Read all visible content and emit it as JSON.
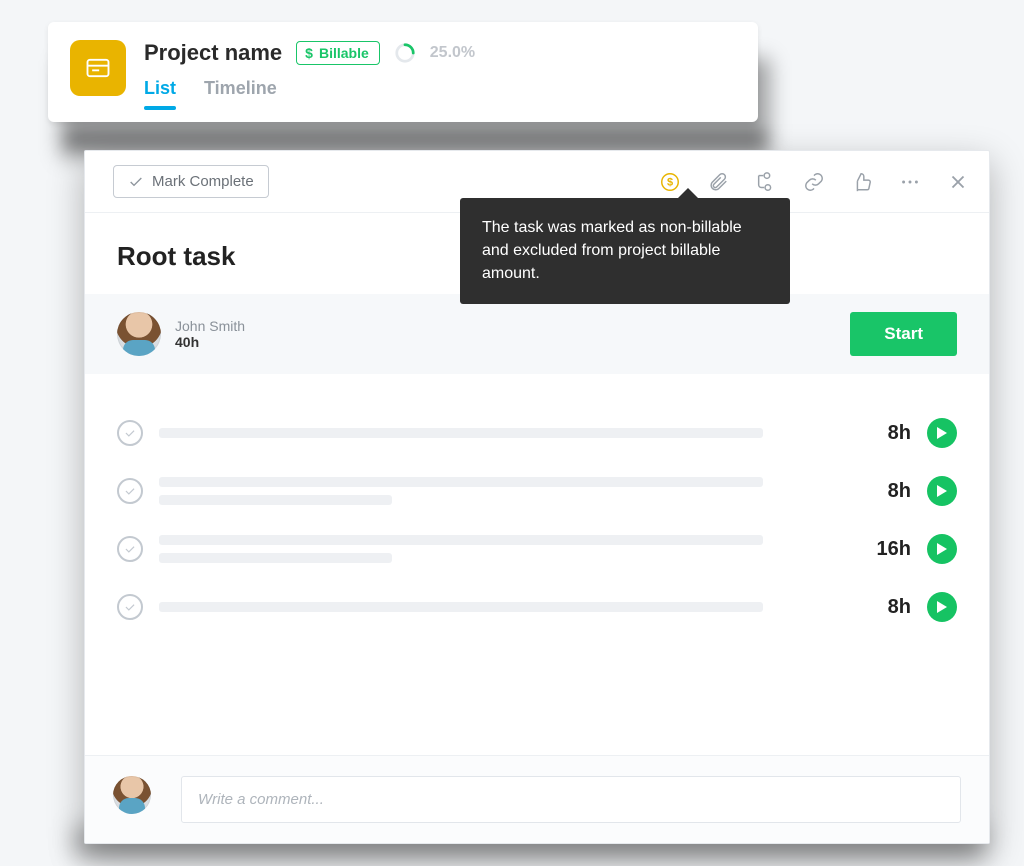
{
  "project": {
    "title": "Project name",
    "billable_label": "Billable",
    "progress_text": "25.0%",
    "progress_value": 25.0,
    "tabs": [
      {
        "label": "List",
        "active": true
      },
      {
        "label": "Timeline",
        "active": false
      }
    ]
  },
  "task_panel": {
    "mark_complete_label": "Mark Complete",
    "toolbar_icons": [
      {
        "name": "billable-icon",
        "tooltip_target": true
      },
      {
        "name": "attachment-icon"
      },
      {
        "name": "subtask-tree-icon"
      },
      {
        "name": "link-icon"
      },
      {
        "name": "like-icon"
      },
      {
        "name": "more-icon"
      },
      {
        "name": "close-icon"
      }
    ],
    "title": "Root task",
    "tooltip_text": "The task was marked as non-billable and  excluded from project billable amount.",
    "assignee": {
      "name": "John Smith",
      "hours": "40h"
    },
    "start_label": "Start",
    "subtasks": [
      {
        "hours": "8h"
      },
      {
        "hours": "8h"
      },
      {
        "hours": "16h"
      },
      {
        "hours": "8h"
      }
    ],
    "comment_placeholder": "Write a comment..."
  },
  "colors": {
    "brand_green": "#19c568",
    "brand_blue": "#00a9e6",
    "brand_yellow": "#e9b400"
  }
}
